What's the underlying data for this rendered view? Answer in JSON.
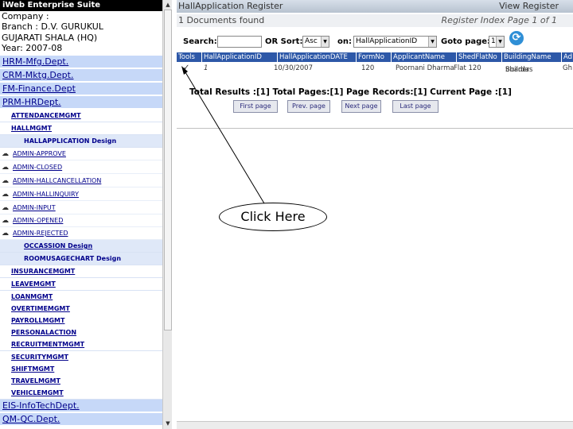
{
  "sidebar": {
    "brand": "iWeb Enterprise Suite",
    "company_lines": [
      "Company :",
      "Branch : D.V. GURUKUL",
      "GUJARATI SHALA (HQ)",
      "Year: 2007-08"
    ],
    "depts": [
      {
        "label": "HRM-Mfg.Dept."
      },
      {
        "label": "CRM-Mktg.Dept."
      },
      {
        "label": "FM-Finance.Dept"
      },
      {
        "label": "PRM-HRDept."
      }
    ],
    "sub_top": [
      {
        "label": "ATTENDANCEMGMT"
      },
      {
        "label": "HALLMGMT"
      }
    ],
    "hall_design": "HALLAPPLICATION Design",
    "leaves": [
      {
        "label": "ADMIN-APPROVE"
      },
      {
        "label": "ADMIN-CLOSED"
      },
      {
        "label": "ADMIN-HALLCANCELLATION"
      },
      {
        "label": "ADMIN-HALLINQUIRY"
      },
      {
        "label": "ADMIN-INPUT"
      },
      {
        "label": "ADMIN-OPENED"
      },
      {
        "label": "ADMIN-REJECTED"
      }
    ],
    "occassion": {
      "label": "OCCASSION",
      "design": "Design"
    },
    "roomusage": {
      "label": "ROOMUSAGECHART",
      "design": "Design"
    },
    "sub_bottom": [
      {
        "label": "INSURANCEMGMT"
      },
      {
        "label": "LEAVEMGMT"
      },
      {
        "label": "LOANMGMT"
      },
      {
        "label": "OVERTIMEMGMT"
      },
      {
        "label": "PAYROLLMGMT"
      },
      {
        "label": "PERSONALACTION"
      },
      {
        "label": "RECRUITMENTMGMT"
      },
      {
        "label": "SECURITYMGMT"
      },
      {
        "label": "SHIFTMGMT"
      },
      {
        "label": "TRAVELMGMT"
      },
      {
        "label": "VEHICLEMGMT"
      }
    ],
    "depts_bottom": [
      {
        "label": "EIS-InfoTechDept."
      },
      {
        "label": "QM-QC.Dept."
      }
    ]
  },
  "main": {
    "title": "HallApplication Register",
    "view_register": "View Register",
    "documents_found": "1 Documents found",
    "register_index": "Register Index Page 1 of 1",
    "search_label": "Search:",
    "search_value": "",
    "or_sort_label": "OR Sort:",
    "sort_value": "Asc",
    "on_label": "on:",
    "on_value": "HallApplicationID",
    "goto_label": "Goto page:",
    "goto_value": "1",
    "columns": [
      "Tools",
      "HallApplicationID",
      "HallApplicationDATE",
      "FormNo",
      "ApplicantName",
      "ShedFlatNo",
      "BuildingName",
      "Ad"
    ],
    "row": {
      "tool": "✓",
      "id": "1",
      "date": "10/30/2007",
      "formno": "120",
      "applicant": "Poornani Dharma",
      "shed": "Flat 120",
      "building_line1": "Sharda",
      "building_line2": "Builders",
      "ad": "Gh"
    },
    "results_text": "Total Results :[1]   Total Pages:[1]   Page Records:[1]   Current Page :[1]",
    "buttons": [
      "First page",
      "Prev. page",
      "Next page",
      "Last page"
    ]
  },
  "callout": {
    "text": "Click Here"
  },
  "colors": {
    "header": "#2d58a8",
    "dept_bg": "#c6d8f8",
    "link": "#00008b"
  },
  "icons": {
    "refresh": "refresh-icon",
    "leaf": "document-icon",
    "tool": "check-icon"
  }
}
